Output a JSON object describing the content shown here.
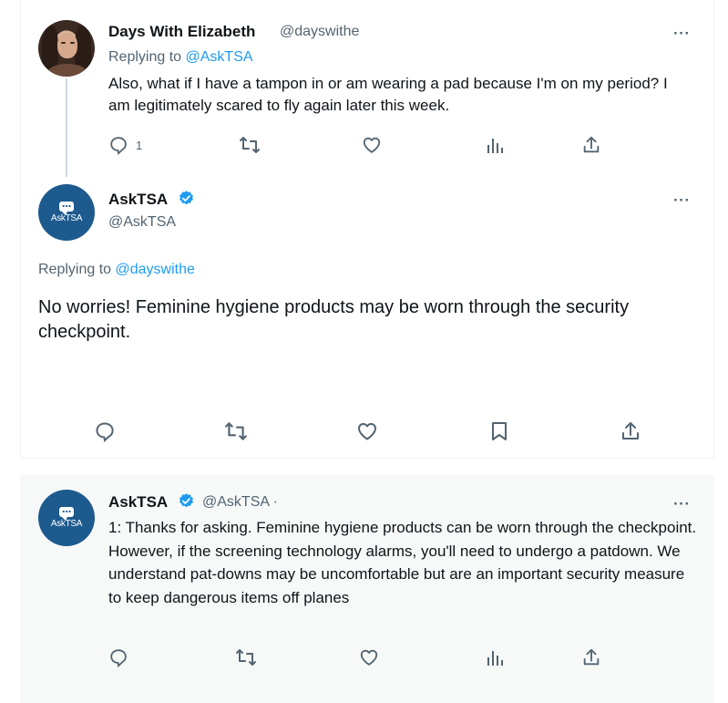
{
  "tweet1": {
    "author_name": "Days With Elizabeth",
    "author_handle": "@dayswithe",
    "replying_prefix": "Replying to ",
    "replying_mention": "@AskTSA",
    "text": "Also, what if I have a tampon in or am wearing a pad because I'm on my period? I am legitimately scared to fly again later this week.",
    "reply_count": "1",
    "more": "···"
  },
  "tweet2": {
    "author_name": "AskTSA",
    "author_handle": "@AskTSA",
    "avatar_label": "AskTSA",
    "replying_prefix": "Replying to ",
    "replying_mention": "@dayswithe",
    "text": "No worries! Feminine hygiene products may be worn through the security checkpoint.",
    "more": "···"
  },
  "tweet3": {
    "author_name": "AskTSA",
    "author_handle": "@AskTSA ·",
    "avatar_label": "AskTSA",
    "text": "1: Thanks for asking. Feminine hygiene products can be worn through the checkpoint. However, if the screening technology alarms, you'll need to undergo a patdown. We understand pat-downs may be uncomfortable but are an important security measure to keep dangerous items off planes",
    "more": "···"
  },
  "colors": {
    "link": "#1d9bf0",
    "muted": "#536471",
    "verified": "#1d9bf0",
    "tsa_blue": "#1d5a8e"
  },
  "icons": [
    "reply-icon",
    "retweet-icon",
    "like-icon",
    "views-icon",
    "share-icon",
    "bookmark-icon",
    "verified-badge-icon",
    "more-icon"
  ]
}
